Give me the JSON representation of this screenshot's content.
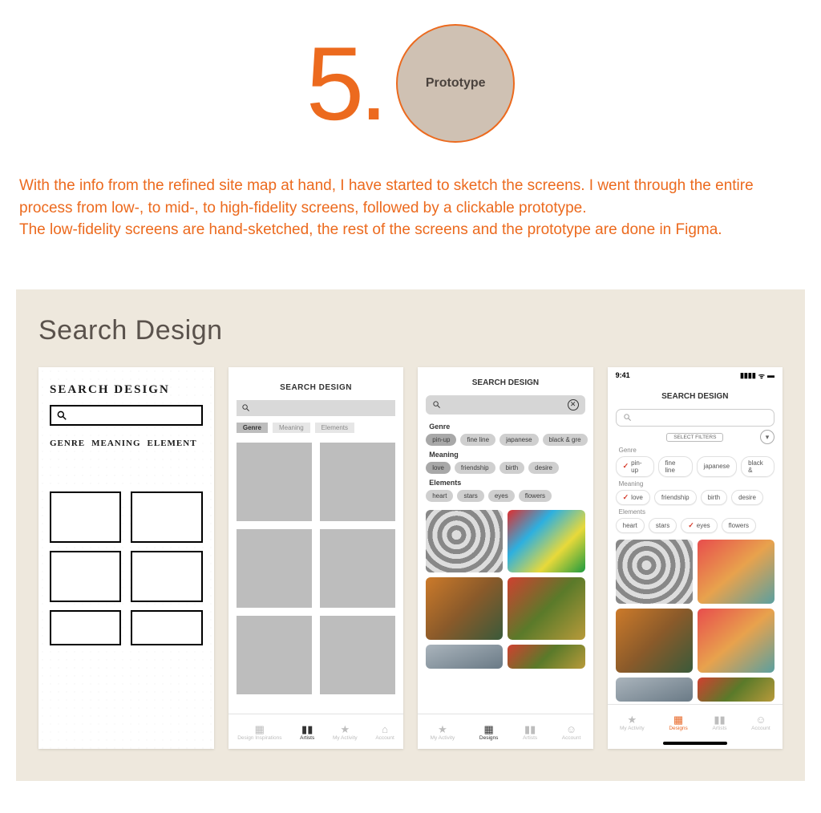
{
  "header": {
    "number": "5.",
    "circle_label": "Prototype"
  },
  "intro": "With the info from the refined site map at hand, I have started to sketch the screens. I went through the entire process from low-, to mid-, to high-fidelity screens, followed by a clickable prototype.\nThe low-fidelity screens are hand-sketched, the rest of the screens and the prototype are done in Figma.",
  "panel_title": "Search Design",
  "sketch": {
    "title": "SEARCH DESIGN",
    "tabs": [
      "GENRE",
      "MEANING",
      "ELEMENT"
    ]
  },
  "lowfi": {
    "title": "SEARCH DESIGN",
    "tabs": [
      {
        "label": "Genre",
        "active": true
      },
      {
        "label": "Meaning",
        "active": false
      },
      {
        "label": "Elements",
        "active": false
      }
    ],
    "nav": [
      "Design Inspirations",
      "Artists",
      "My Activity",
      "Account"
    ]
  },
  "midfi": {
    "title": "SEARCH DESIGN",
    "sections": {
      "Genre": [
        {
          "t": "pin-up",
          "s": true
        },
        {
          "t": "fine line",
          "s": false
        },
        {
          "t": "japanese",
          "s": false
        },
        {
          "t": "black & gre",
          "s": false
        }
      ],
      "Meaning": [
        {
          "t": "love",
          "s": true
        },
        {
          "t": "friendship",
          "s": false
        },
        {
          "t": "birth",
          "s": false
        },
        {
          "t": "desire",
          "s": false
        }
      ],
      "Elements": [
        {
          "t": "heart",
          "s": false
        },
        {
          "t": "stars",
          "s": false
        },
        {
          "t": "eyes",
          "s": false
        },
        {
          "t": "flowers",
          "s": false
        }
      ]
    },
    "nav": [
      "My Activity",
      "Designs",
      "Artists",
      "Account"
    ]
  },
  "hifi": {
    "time": "9:41",
    "title": "SEARCH DESIGN",
    "filters_label": "SELECT FILTERS",
    "sections": {
      "Genre": [
        {
          "t": "pin-up",
          "c": true
        },
        {
          "t": "fine line",
          "c": false
        },
        {
          "t": "japanese",
          "c": false
        },
        {
          "t": "black &",
          "c": false
        }
      ],
      "Meaning": [
        {
          "t": "love",
          "c": true
        },
        {
          "t": "friendship",
          "c": false
        },
        {
          "t": "birth",
          "c": false
        },
        {
          "t": "desire",
          "c": false
        }
      ],
      "Elements": [
        {
          "t": "heart",
          "c": false
        },
        {
          "t": "stars",
          "c": false
        },
        {
          "t": "eyes",
          "c": true
        },
        {
          "t": "flowers",
          "c": false
        }
      ]
    },
    "nav": [
      "My Activity",
      "Designs",
      "Artists",
      "Account"
    ]
  }
}
